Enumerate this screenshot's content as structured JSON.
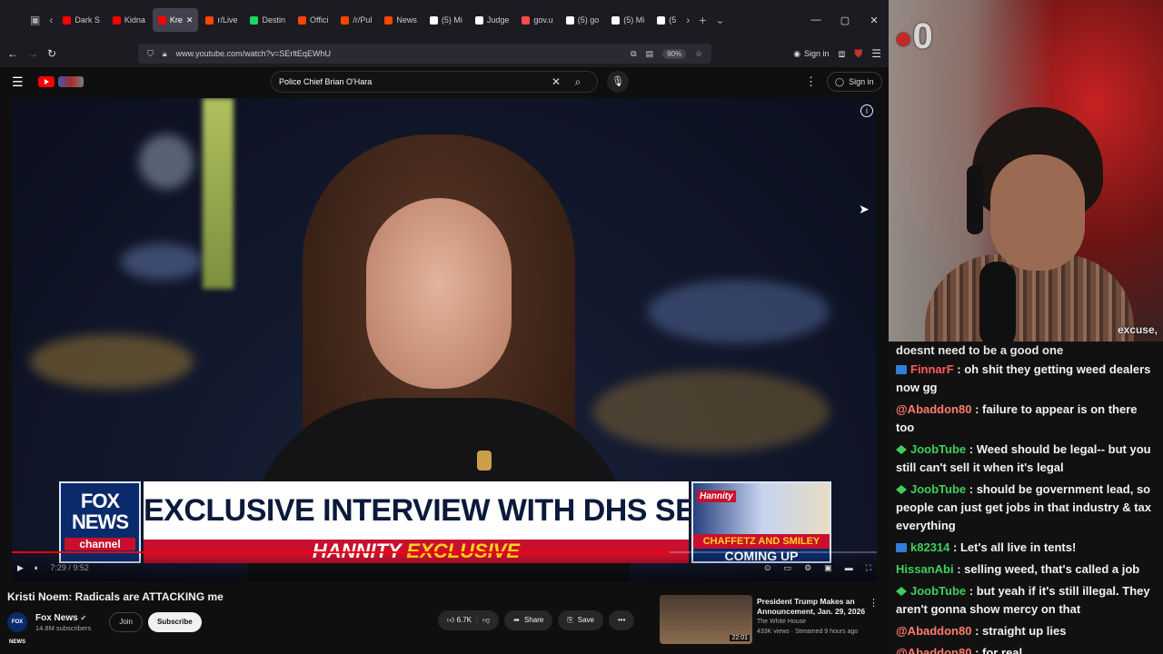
{
  "browser": {
    "tabs": [
      {
        "label": "Dark S",
        "color": "#ff0000"
      },
      {
        "label": "Kidna",
        "color": "#ff0000"
      },
      {
        "label": "Kre",
        "color": "#ff0000",
        "active": true
      },
      {
        "label": "r/Live",
        "color": "#ff4500"
      },
      {
        "label": "Destin",
        "color": "#1ed760"
      },
      {
        "label": "Offici",
        "color": "#ff4500"
      },
      {
        "label": "/r/Pul",
        "color": "#ff4500"
      },
      {
        "label": "News",
        "color": "#ff4500"
      },
      {
        "label": "(5) Mi",
        "color": "#ffffff"
      },
      {
        "label": "Judge",
        "color": "#ffffff"
      },
      {
        "label": "gov.u",
        "color": "#ff4a4a"
      },
      {
        "label": "(5) go",
        "color": "#ffffff"
      },
      {
        "label": "(5) Mi",
        "color": "#ffffff"
      },
      {
        "label": "(5",
        "color": "#ffffff"
      }
    ],
    "url": "www.youtube.com/watch?v=SErltEqEWhU",
    "zoom": "90%",
    "signin_label": "Sign in"
  },
  "youtube": {
    "search_query": "Police Chief Brian O'Hara",
    "signin_label": "Sign in",
    "video": {
      "headline": "EXCLUSIVE INTERVIEW WITH DHS SECRETARY NOEM",
      "subline_part1": "HANNITY",
      "subline_part2": "EXCLUSIVE",
      "logo_line1": "FOX",
      "logo_line2": "NEWS",
      "logo_line3": "channel",
      "promo_brand": "Hannity",
      "promo_line1": "CHAFFETZ AND SMILEY",
      "promo_line2": "COMING UP",
      "time": "7:29 / 9:52",
      "progress_fraction": 0.76
    },
    "title": "Kristi Noem: Radicals are ATTACKING me",
    "channel": {
      "name": "Fox News",
      "subscribers": "14.8M subscribers",
      "avatar_text": "FOX NEWS",
      "join_label": "Join",
      "subscribe_label": "Subscribe"
    },
    "actions": {
      "likes": "6.7K",
      "share_label": "Share",
      "save_label": "Save"
    },
    "recommended": {
      "title": "President Trump Makes an Announcement, Jan. 29, 2026",
      "channel": "The White House",
      "stats": "433K views · Streamed 9 hours ago",
      "duration": "22:01"
    }
  },
  "stream": {
    "counter": "0",
    "caption": "excuse,"
  },
  "chat": {
    "partial_line": "doesnt need to be a good one",
    "messages": [
      {
        "badge": "prime",
        "user": "FinnarF",
        "color": "#ff5c5c",
        "text": "oh shit they getting weed dealers now gg"
      },
      {
        "badge": "",
        "user": "@Abaddon80",
        "color": "#ff7b6b",
        "text": "failure to appear is on there too"
      },
      {
        "badge": "gem",
        "user": "JoobTube",
        "color": "#3ecf5b",
        "text": "Weed should be legal-- but you still can't sell it when it's legal"
      },
      {
        "badge": "gem",
        "user": "JoobTube",
        "color": "#3ecf5b",
        "text": "should be government lead, so people can just get jobs in that industry & tax everything"
      },
      {
        "badge": "prime",
        "user": "k82314",
        "color": "#3ecf5b",
        "text": "Let's all live in tents!"
      },
      {
        "badge": "",
        "user": "HissanAbi",
        "color": "#3ecf5b",
        "text": "selling weed, that's called a job"
      },
      {
        "badge": "gem",
        "user": "JoobTube",
        "color": "#3ecf5b",
        "text": "but yeah if it's still illegal. They aren't gonna show mercy on that"
      },
      {
        "badge": "",
        "user": "@Abaddon80",
        "color": "#ff7b6b",
        "text": "straight up lies"
      },
      {
        "badge": "",
        "user": "@Abaddon80",
        "color": "#ff7b6b",
        "text": "for real"
      }
    ]
  }
}
